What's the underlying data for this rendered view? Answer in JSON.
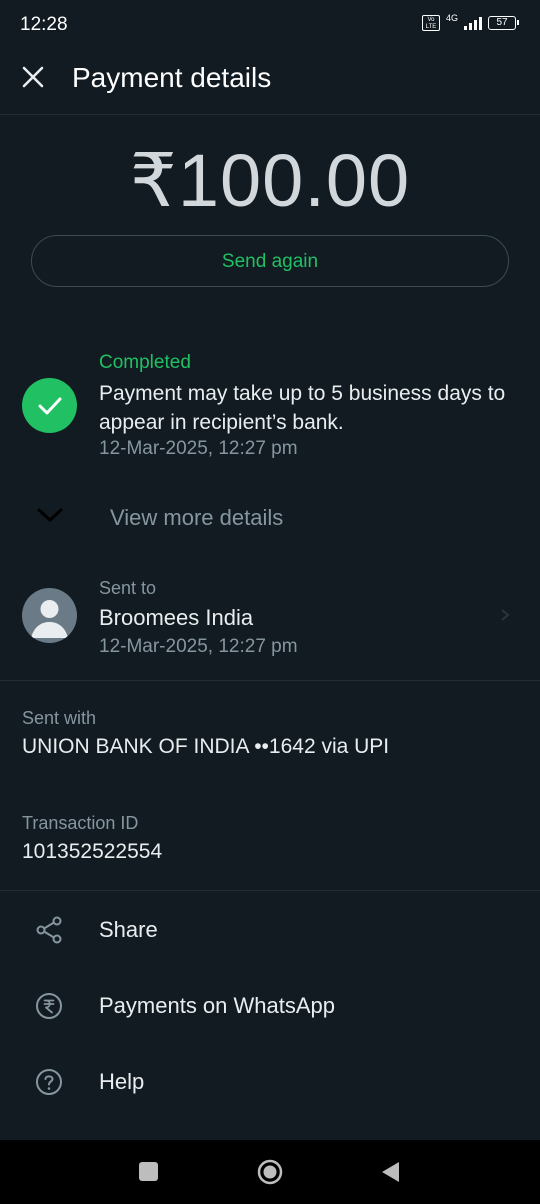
{
  "status_bar": {
    "time": "12:28",
    "network": "4G",
    "battery": "57",
    "volte": "Vo LTE"
  },
  "header": {
    "title": "Payment details",
    "close_icon": "close-icon"
  },
  "payment": {
    "amount": "₹100.00",
    "send_again_label": "Send again"
  },
  "status": {
    "state": "Completed",
    "message": "Payment may take up to 5 business days to appear in recipient’s bank.",
    "timestamp": "12-Mar-2025, 12:27 pm",
    "icon": "check-icon"
  },
  "more_details": {
    "label": "View more details",
    "icon": "chevron-down-icon"
  },
  "recipient": {
    "label": "Sent to",
    "name": "Broomees India",
    "timestamp": "12-Mar-2025, 12:27 pm",
    "icon": "avatar-icon"
  },
  "sent_with": {
    "label": "Sent with",
    "value": "UNION BANK OF INDIA ••1642 via UPI"
  },
  "transaction": {
    "label": "Transaction ID",
    "value": "101352522554"
  },
  "actions": [
    {
      "label": "Share",
      "icon": "share-icon"
    },
    {
      "label": "Payments on WhatsApp",
      "icon": "rupee-icon"
    },
    {
      "label": "Help",
      "icon": "help-icon"
    }
  ],
  "colors": {
    "background": "#111b21",
    "accent": "#21c063",
    "secondary_text": "#8696a0",
    "primary_text": "#e9edef"
  }
}
